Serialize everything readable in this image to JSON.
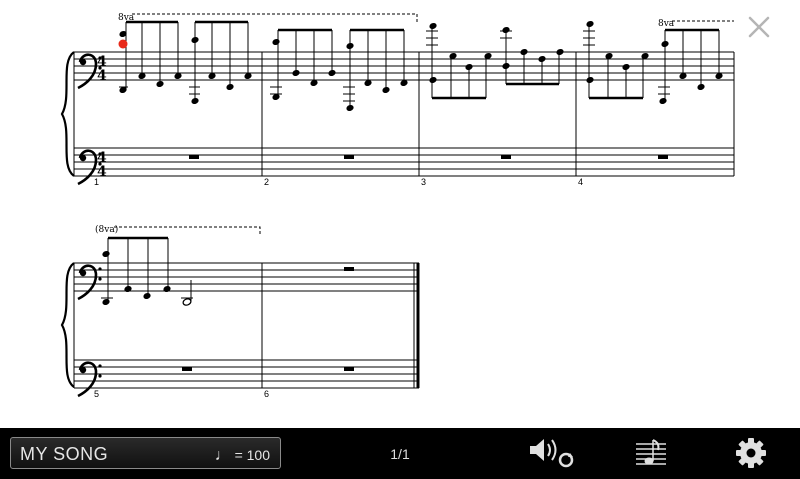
{
  "score": {
    "octave_mark": "8va",
    "octave_mark_paren": "(8va)",
    "measure_numbers": [
      "1",
      "2",
      "3",
      "4",
      "5",
      "6"
    ]
  },
  "player": {
    "song_name": "MY SONG",
    "tempo_symbol": "♩",
    "tempo_value": "= 100",
    "page_indicator": "1/1"
  },
  "icons": {
    "close": "close-icon",
    "volume_loop": "speaker-loop-icon",
    "score_settings": "score-icon",
    "settings": "gear-icon"
  },
  "colors": {
    "playhead": "#e82a1a",
    "bar_bg": "#000000"
  }
}
